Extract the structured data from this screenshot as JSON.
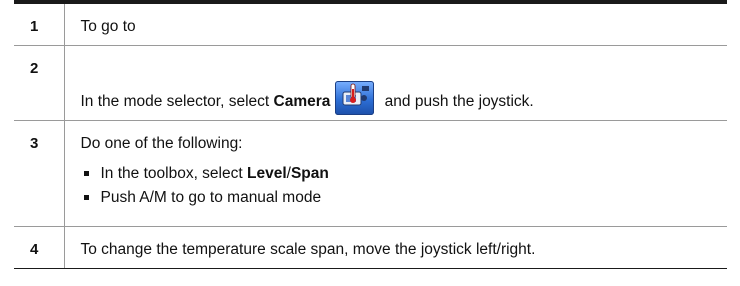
{
  "steps": [
    {
      "num": "1",
      "text": "To go to"
    },
    {
      "num": "2",
      "prefix": "In the mode selector, select ",
      "bold": "Camera",
      "suffix": " and push the joystick.",
      "icon": "camera-thermometer-icon"
    },
    {
      "num": "3",
      "text": "Do one of the following:",
      "bullets": [
        {
          "prefix": "In the toolbox, select ",
          "bold_a": "Level",
          "sep": "/",
          "bold_b": "Span"
        },
        {
          "text": "Push A/M to go to manual mode"
        }
      ]
    },
    {
      "num": "4",
      "text": "To change the temperature scale span, move the joystick left/right."
    }
  ]
}
